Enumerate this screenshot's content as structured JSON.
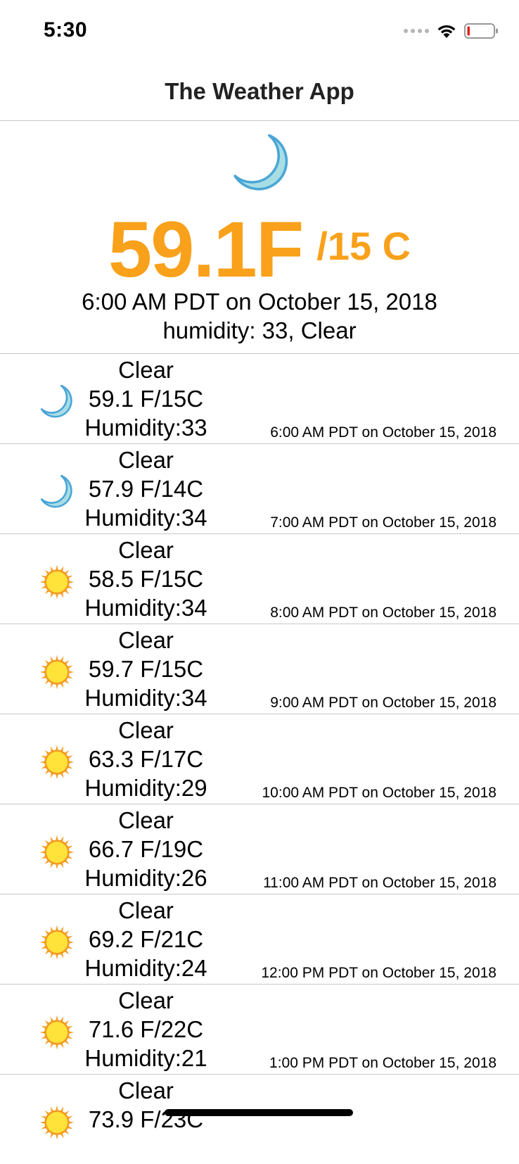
{
  "status_bar": {
    "time": "5:30"
  },
  "nav": {
    "title": "The Weather App"
  },
  "current": {
    "icon": "moon-icon",
    "temp_f": "59.1F",
    "temp_c": "/15 C",
    "time": "6:00 AM PDT on October 15, 2018",
    "humidity_line": "humidity: 33, Clear"
  },
  "forecast": [
    {
      "icon": "moon-icon",
      "condition": "Clear",
      "temp": "59.1 F/15C",
      "humidity": "Humidity:33",
      "time": "6:00 AM PDT on October 15, 2018"
    },
    {
      "icon": "moon-icon",
      "condition": "Clear",
      "temp": "57.9 F/14C",
      "humidity": "Humidity:34",
      "time": "7:00 AM PDT on October 15, 2018"
    },
    {
      "icon": "sun-icon",
      "condition": "Clear",
      "temp": "58.5 F/15C",
      "humidity": "Humidity:34",
      "time": "8:00 AM PDT on October 15, 2018"
    },
    {
      "icon": "sun-icon",
      "condition": "Clear",
      "temp": "59.7 F/15C",
      "humidity": "Humidity:34",
      "time": "9:00 AM PDT on October 15, 2018"
    },
    {
      "icon": "sun-icon",
      "condition": "Clear",
      "temp": "63.3 F/17C",
      "humidity": "Humidity:29",
      "time": "10:00 AM PDT on October 15, 2018"
    },
    {
      "icon": "sun-icon",
      "condition": "Clear",
      "temp": "66.7 F/19C",
      "humidity": "Humidity:26",
      "time": "11:00 AM PDT on October 15, 2018"
    },
    {
      "icon": "sun-icon",
      "condition": "Clear",
      "temp": "69.2 F/21C",
      "humidity": "Humidity:24",
      "time": "12:00 PM PDT on October 15, 2018"
    },
    {
      "icon": "sun-icon",
      "condition": "Clear",
      "temp": "71.6 F/22C",
      "humidity": "Humidity:21",
      "time": "1:00 PM PDT on October 15, 2018"
    },
    {
      "icon": "sun-icon",
      "condition": "Clear",
      "temp": "73.9 F/23C",
      "humidity": "",
      "time": ""
    }
  ],
  "colors": {
    "accent_temp": "#f9a11b",
    "moon": "#a8dde4",
    "moon_stroke": "#4aa6d6",
    "sun_fill": "#ffe23a",
    "sun_rays": "#f39a1f",
    "battery_low": "#e0201b"
  }
}
